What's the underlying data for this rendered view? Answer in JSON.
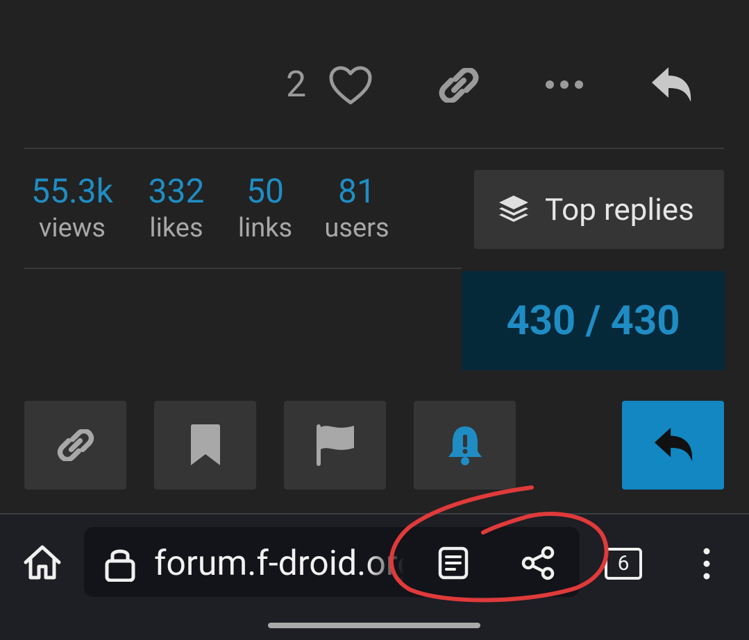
{
  "post_actions": {
    "like_count": "2",
    "icons": [
      "heart-icon",
      "link-icon",
      "more-icon",
      "reply-icon"
    ]
  },
  "topic_stats": [
    {
      "value": "55.3k",
      "label": "views"
    },
    {
      "value": "332",
      "label": "likes"
    },
    {
      "value": "50",
      "label": "links"
    },
    {
      "value": "81",
      "label": "users"
    }
  ],
  "top_replies": {
    "label": "Top replies"
  },
  "progress": {
    "text": "430 / 430",
    "current": 430,
    "total": 430
  },
  "footer_buttons": [
    "link-icon",
    "bookmark-icon",
    "flag-icon",
    "bell-icon",
    "reply-icon"
  ],
  "browser": {
    "url": "forum.f-droid.org",
    "tab_count": "6"
  },
  "colors": {
    "background": "#222222",
    "accent": "#1f8dc4",
    "reply_button": "#1287c2",
    "progress_bg": "#06293a",
    "annotation": "#e03a3a"
  }
}
